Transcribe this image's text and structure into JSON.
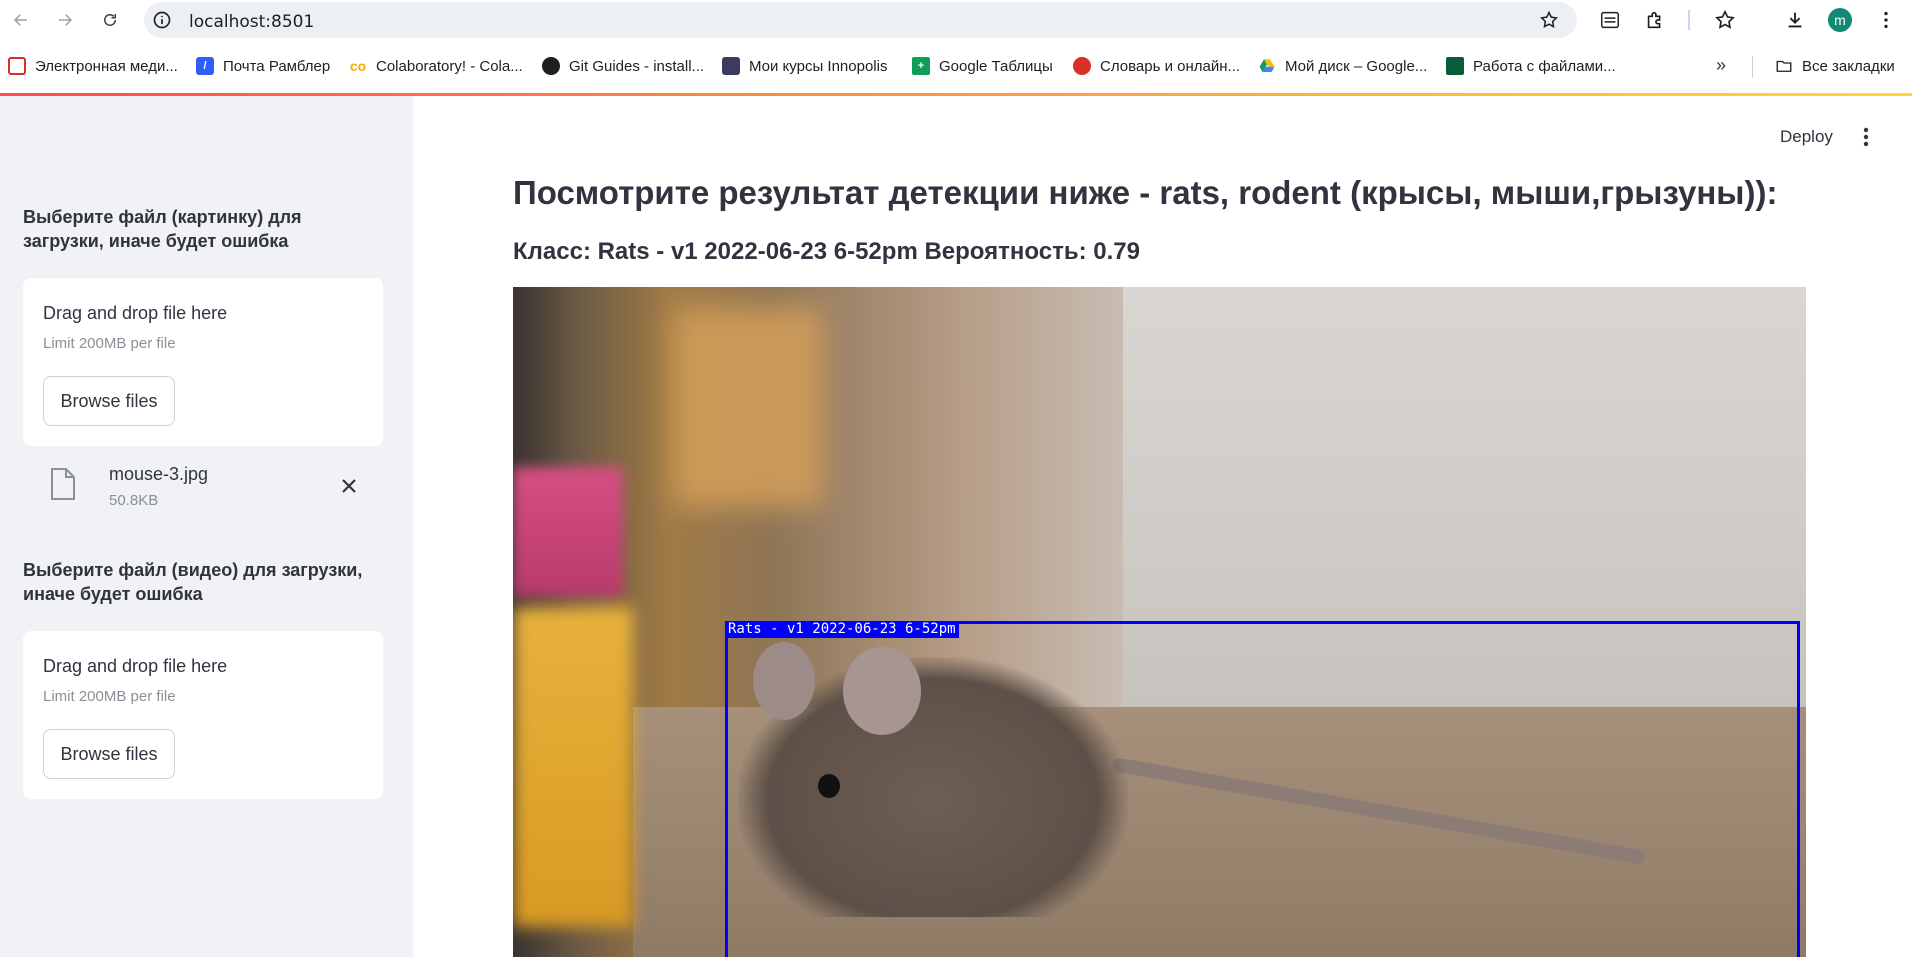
{
  "browser": {
    "url": "localhost:8501",
    "profile_initial": "m",
    "bookmarks": [
      {
        "label": "Электронная меди...",
        "icon": "bookmark-red-icon",
        "color": "#d93025"
      },
      {
        "label": "Почта Рамблер",
        "icon": "rambler-icon",
        "color": "#315efb"
      },
      {
        "label": "Colaboratory! - Cola...",
        "icon": "colab-icon",
        "color": "#f9ab00"
      },
      {
        "label": "Git Guides - install...",
        "icon": "github-icon",
        "color": "#1f1f1f"
      },
      {
        "label": "Мои курсы Innopolis",
        "icon": "innopolis-icon",
        "color": "#3c3a5e"
      },
      {
        "label": "Google Таблицы",
        "icon": "google-sheets-icon",
        "color": "#0f9d58"
      },
      {
        "label": "Словарь и онлайн...",
        "icon": "dictionary-icon",
        "color": "#d93025"
      },
      {
        "label": "Мой диск – Google...",
        "icon": "google-drive-icon",
        "color": "#fbbc04"
      },
      {
        "label": "Работа с файлами...",
        "icon": "files-icon",
        "color": "#0b5d3a"
      }
    ],
    "all_bookmarks_label": "Все закладки"
  },
  "app": {
    "deploy_label": "Deploy",
    "title": "Посмотрите результат детекции ниже - rats, rodent (крысы, мыши,грызуны)):",
    "result": "Класс: Rats - v1 2022-06-23 6-52pm Вероятность: 0.79",
    "detection_label": "Rats - v1 2022-06-23 6-52pm"
  },
  "sidebar": {
    "image_uploader": {
      "label": "Выберите файл (картинку) для загрузки, иначе будет ошибка",
      "drop_text": "Drag and drop file here",
      "limit": "Limit 200MB per file",
      "button": "Browse files"
    },
    "uploaded_file": {
      "name": "mouse-3.jpg",
      "size": "50.8KB"
    },
    "video_uploader": {
      "label": "Выберите файл (видео) для загрузки, иначе будет ошибка",
      "drop_text": "Drag and drop file here",
      "limit": "Limit 200MB per file",
      "button": "Browse files"
    }
  }
}
